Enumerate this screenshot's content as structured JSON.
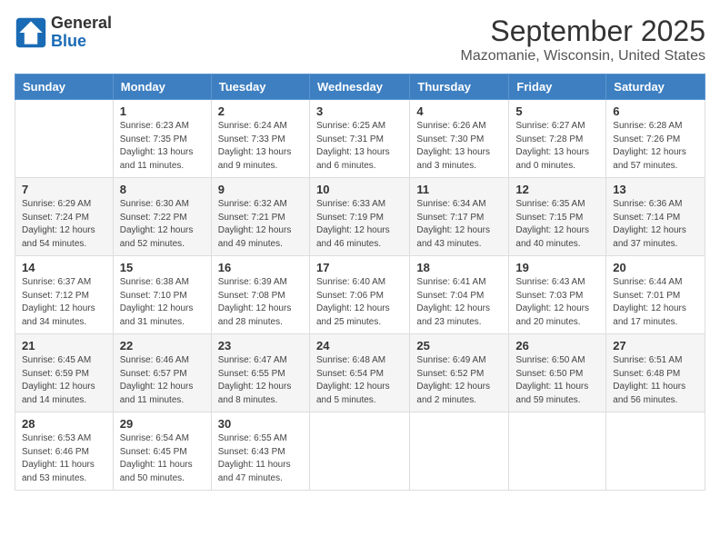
{
  "header": {
    "logo_general": "General",
    "logo_blue": "Blue",
    "month_title": "September 2025",
    "location": "Mazomanie, Wisconsin, United States"
  },
  "calendar": {
    "days_of_week": [
      "Sunday",
      "Monday",
      "Tuesday",
      "Wednesday",
      "Thursday",
      "Friday",
      "Saturday"
    ],
    "weeks": [
      [
        {
          "day": "",
          "sunrise": "",
          "sunset": "",
          "daylight": "",
          "empty": true
        },
        {
          "day": "1",
          "sunrise": "Sunrise: 6:23 AM",
          "sunset": "Sunset: 7:35 PM",
          "daylight": "Daylight: 13 hours and 11 minutes."
        },
        {
          "day": "2",
          "sunrise": "Sunrise: 6:24 AM",
          "sunset": "Sunset: 7:33 PM",
          "daylight": "Daylight: 13 hours and 9 minutes."
        },
        {
          "day": "3",
          "sunrise": "Sunrise: 6:25 AM",
          "sunset": "Sunset: 7:31 PM",
          "daylight": "Daylight: 13 hours and 6 minutes."
        },
        {
          "day": "4",
          "sunrise": "Sunrise: 6:26 AM",
          "sunset": "Sunset: 7:30 PM",
          "daylight": "Daylight: 13 hours and 3 minutes."
        },
        {
          "day": "5",
          "sunrise": "Sunrise: 6:27 AM",
          "sunset": "Sunset: 7:28 PM",
          "daylight": "Daylight: 13 hours and 0 minutes."
        },
        {
          "day": "6",
          "sunrise": "Sunrise: 6:28 AM",
          "sunset": "Sunset: 7:26 PM",
          "daylight": "Daylight: 12 hours and 57 minutes."
        }
      ],
      [
        {
          "day": "7",
          "sunrise": "Sunrise: 6:29 AM",
          "sunset": "Sunset: 7:24 PM",
          "daylight": "Daylight: 12 hours and 54 minutes."
        },
        {
          "day": "8",
          "sunrise": "Sunrise: 6:30 AM",
          "sunset": "Sunset: 7:22 PM",
          "daylight": "Daylight: 12 hours and 52 minutes."
        },
        {
          "day": "9",
          "sunrise": "Sunrise: 6:32 AM",
          "sunset": "Sunset: 7:21 PM",
          "daylight": "Daylight: 12 hours and 49 minutes."
        },
        {
          "day": "10",
          "sunrise": "Sunrise: 6:33 AM",
          "sunset": "Sunset: 7:19 PM",
          "daylight": "Daylight: 12 hours and 46 minutes."
        },
        {
          "day": "11",
          "sunrise": "Sunrise: 6:34 AM",
          "sunset": "Sunset: 7:17 PM",
          "daylight": "Daylight: 12 hours and 43 minutes."
        },
        {
          "day": "12",
          "sunrise": "Sunrise: 6:35 AM",
          "sunset": "Sunset: 7:15 PM",
          "daylight": "Daylight: 12 hours and 40 minutes."
        },
        {
          "day": "13",
          "sunrise": "Sunrise: 6:36 AM",
          "sunset": "Sunset: 7:14 PM",
          "daylight": "Daylight: 12 hours and 37 minutes."
        }
      ],
      [
        {
          "day": "14",
          "sunrise": "Sunrise: 6:37 AM",
          "sunset": "Sunset: 7:12 PM",
          "daylight": "Daylight: 12 hours and 34 minutes."
        },
        {
          "day": "15",
          "sunrise": "Sunrise: 6:38 AM",
          "sunset": "Sunset: 7:10 PM",
          "daylight": "Daylight: 12 hours and 31 minutes."
        },
        {
          "day": "16",
          "sunrise": "Sunrise: 6:39 AM",
          "sunset": "Sunset: 7:08 PM",
          "daylight": "Daylight: 12 hours and 28 minutes."
        },
        {
          "day": "17",
          "sunrise": "Sunrise: 6:40 AM",
          "sunset": "Sunset: 7:06 PM",
          "daylight": "Daylight: 12 hours and 25 minutes."
        },
        {
          "day": "18",
          "sunrise": "Sunrise: 6:41 AM",
          "sunset": "Sunset: 7:04 PM",
          "daylight": "Daylight: 12 hours and 23 minutes."
        },
        {
          "day": "19",
          "sunrise": "Sunrise: 6:43 AM",
          "sunset": "Sunset: 7:03 PM",
          "daylight": "Daylight: 12 hours and 20 minutes."
        },
        {
          "day": "20",
          "sunrise": "Sunrise: 6:44 AM",
          "sunset": "Sunset: 7:01 PM",
          "daylight": "Daylight: 12 hours and 17 minutes."
        }
      ],
      [
        {
          "day": "21",
          "sunrise": "Sunrise: 6:45 AM",
          "sunset": "Sunset: 6:59 PM",
          "daylight": "Daylight: 12 hours and 14 minutes."
        },
        {
          "day": "22",
          "sunrise": "Sunrise: 6:46 AM",
          "sunset": "Sunset: 6:57 PM",
          "daylight": "Daylight: 12 hours and 11 minutes."
        },
        {
          "day": "23",
          "sunrise": "Sunrise: 6:47 AM",
          "sunset": "Sunset: 6:55 PM",
          "daylight": "Daylight: 12 hours and 8 minutes."
        },
        {
          "day": "24",
          "sunrise": "Sunrise: 6:48 AM",
          "sunset": "Sunset: 6:54 PM",
          "daylight": "Daylight: 12 hours and 5 minutes."
        },
        {
          "day": "25",
          "sunrise": "Sunrise: 6:49 AM",
          "sunset": "Sunset: 6:52 PM",
          "daylight": "Daylight: 12 hours and 2 minutes."
        },
        {
          "day": "26",
          "sunrise": "Sunrise: 6:50 AM",
          "sunset": "Sunset: 6:50 PM",
          "daylight": "Daylight: 11 hours and 59 minutes."
        },
        {
          "day": "27",
          "sunrise": "Sunrise: 6:51 AM",
          "sunset": "Sunset: 6:48 PM",
          "daylight": "Daylight: 11 hours and 56 minutes."
        }
      ],
      [
        {
          "day": "28",
          "sunrise": "Sunrise: 6:53 AM",
          "sunset": "Sunset: 6:46 PM",
          "daylight": "Daylight: 11 hours and 53 minutes."
        },
        {
          "day": "29",
          "sunrise": "Sunrise: 6:54 AM",
          "sunset": "Sunset: 6:45 PM",
          "daylight": "Daylight: 11 hours and 50 minutes."
        },
        {
          "day": "30",
          "sunrise": "Sunrise: 6:55 AM",
          "sunset": "Sunset: 6:43 PM",
          "daylight": "Daylight: 11 hours and 47 minutes."
        },
        {
          "day": "",
          "sunrise": "",
          "sunset": "",
          "daylight": "",
          "empty": true
        },
        {
          "day": "",
          "sunrise": "",
          "sunset": "",
          "daylight": "",
          "empty": true
        },
        {
          "day": "",
          "sunrise": "",
          "sunset": "",
          "daylight": "",
          "empty": true
        },
        {
          "day": "",
          "sunrise": "",
          "sunset": "",
          "daylight": "",
          "empty": true
        }
      ]
    ]
  }
}
